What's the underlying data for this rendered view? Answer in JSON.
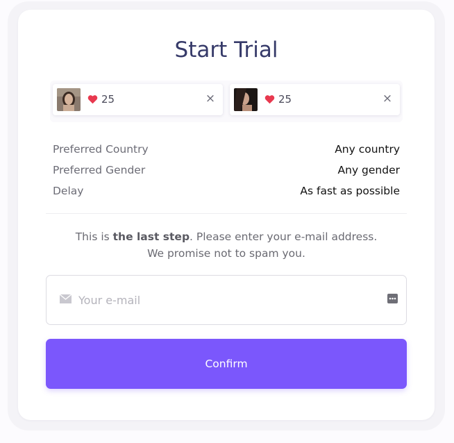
{
  "title": "Start Trial",
  "chips": [
    {
      "count": "25",
      "close": "×"
    },
    {
      "count": "25",
      "close": "×"
    }
  ],
  "preferences": [
    {
      "label": "Preferred Country",
      "value": "Any country"
    },
    {
      "label": "Preferred Gender",
      "value": "Any gender"
    },
    {
      "label": "Delay",
      "value": "As fast as possible"
    }
  ],
  "message": {
    "prefix": "This is ",
    "bold": "the last step",
    "suffix": ". Please enter your e-mail address.",
    "line2": "We promise not to spam you."
  },
  "email": {
    "placeholder": "Your e-mail",
    "value": ""
  },
  "confirm_label": "Confirm",
  "colors": {
    "accent": "#7b57fc",
    "title": "#363a69",
    "heart": "#e8394f"
  }
}
